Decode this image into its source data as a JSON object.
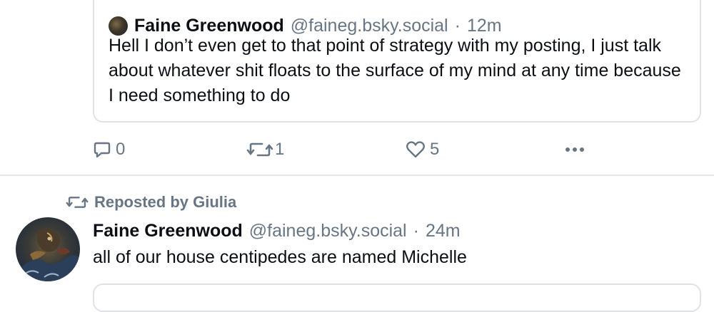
{
  "quoted_post": {
    "author_name": "Faine Greenwood",
    "handle": "@faineg.bsky.social",
    "separator": "·",
    "time": "12m",
    "text": "Hell I don’t even get to that point of strategy with my posting, I just talk about whatever shit floats to the surface of my mind at any time because I need something to do"
  },
  "actions": {
    "reply_count": "0",
    "repost_count": "1",
    "like_count": "5",
    "icons": [
      "reply-icon",
      "repost-icon",
      "like-icon",
      "more-icon"
    ]
  },
  "next_post": {
    "repost_label": "Reposted by Giulia",
    "author_name": "Faine Greenwood",
    "handle": "@faineg.bsky.social",
    "separator": "·",
    "time": "24m",
    "text": "all of our house centipedes are named Michelle"
  },
  "colors": {
    "text": "#0b0f14",
    "muted": "#687684",
    "border": "#dfe3e8"
  }
}
